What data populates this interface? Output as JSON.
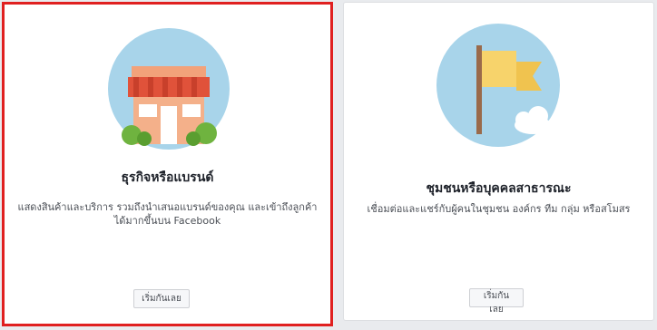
{
  "cards": [
    {
      "title": "ธุรกิจหรือแบรนด์",
      "description": "แสดงสินค้าและบริการ รวมถึงนำเสนอแบรนด์ของคุณ และเข้าถึงลูกค้าได้มากขึ้นบน Facebook",
      "button_label": "เริ่มกันเลย",
      "icon": "storefront-icon",
      "selected": true
    },
    {
      "title": "ชุมชนหรือบุคคลสาธารณะ",
      "description": "เชื่อมต่อและแชร์กับผู้คนในชุมชน องค์กร ทีม กลุ่ม หรือสโมสร",
      "button_label": "เริ่มกันเลย",
      "icon": "flag-icon",
      "selected": false
    }
  ],
  "colors": {
    "selection_border": "#e02020",
    "illustration_circle": "#a8d4ea",
    "awning_red": "#e0523a",
    "flag_yellow": "#f7d36b"
  }
}
